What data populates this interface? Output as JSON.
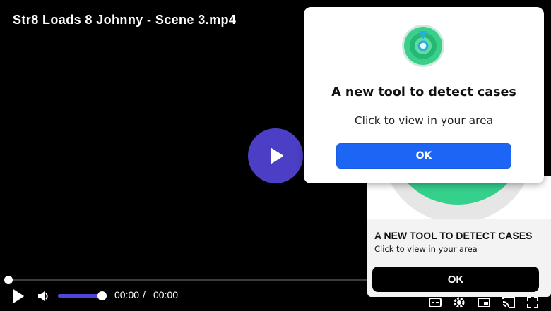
{
  "player": {
    "title": "Str8 Loads 8 Johnny - Scene 3.mp4",
    "current_time": "00:00",
    "time_separator": "/",
    "duration": "00:00",
    "progress_fraction": 0,
    "volume_fraction": 1,
    "accent_color": "#4f46d9",
    "icons": {
      "big_play": "play-icon",
      "play": "play-icon",
      "volume": "volume-icon",
      "captions": "captions-icon",
      "settings": "gear-icon",
      "pip": "picture-in-picture-icon",
      "cast": "cast-icon",
      "fullscreen": "fullscreen-icon"
    }
  },
  "popup": {
    "icon": "location-target-icon",
    "title": "A new tool to detect cases",
    "subtitle": "Click to view in your area",
    "ok_label": "OK",
    "button_color": "#1d66f5"
  },
  "ad_card": {
    "headline": "A NEW TOOL TO DETECT CASES",
    "subline": "Click to view in your area",
    "ok_label": "OK",
    "image_color": "#34d08c"
  }
}
